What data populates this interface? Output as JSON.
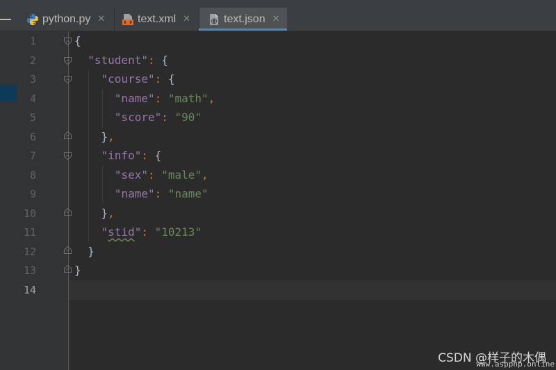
{
  "tabs": [
    {
      "label": "python.py",
      "icon": "python-file-icon",
      "active": false
    },
    {
      "label": "text.xml",
      "icon": "xml-file-icon",
      "active": false
    },
    {
      "label": "text.json",
      "icon": "json-file-icon",
      "active": true
    }
  ],
  "colors": {
    "keyword": "#9876aa",
    "string": "#6a8759",
    "comma": "#cc7832",
    "brace": "#a9b7c6",
    "accent": "#4a88c7"
  },
  "editor": {
    "line_numbers": [
      "1",
      "2",
      "3",
      "4",
      "5",
      "6",
      "7",
      "8",
      "9",
      "10",
      "11",
      "12",
      "13",
      "14"
    ],
    "current_line": "14",
    "lines": {
      "l1": {
        "open": "{"
      },
      "l2": {
        "key": "\"student\"",
        "colon": ": ",
        "open": "{"
      },
      "l3": {
        "key": "\"course\"",
        "colon": ": ",
        "open": "{"
      },
      "l4": {
        "key": "\"name\"",
        "colon": ": ",
        "value": "\"math\"",
        "comma": ","
      },
      "l5": {
        "key": "\"score\"",
        "colon": ": ",
        "value": "\"90\""
      },
      "l6": {
        "close": "}",
        "comma": ","
      },
      "l7": {
        "key": "\"info\"",
        "colon": ": ",
        "open": "{"
      },
      "l8": {
        "key": "\"sex\"",
        "colon": ": ",
        "value": "\"male\"",
        "comma": ","
      },
      "l9": {
        "key": "\"name\"",
        "colon": ": ",
        "value": "\"name\""
      },
      "l10": {
        "close": "}",
        "comma": ","
      },
      "l11": {
        "key_quote_open": "\"",
        "key_word": "stid",
        "key_quote_close": "\"",
        "colon": ": ",
        "value": "\"10213\""
      },
      "l12": {
        "close": "}"
      },
      "l13": {
        "close": "}"
      }
    }
  },
  "watermark": {
    "text": "CSDN @样子的木偶",
    "sub": "www.aspphp.online"
  }
}
